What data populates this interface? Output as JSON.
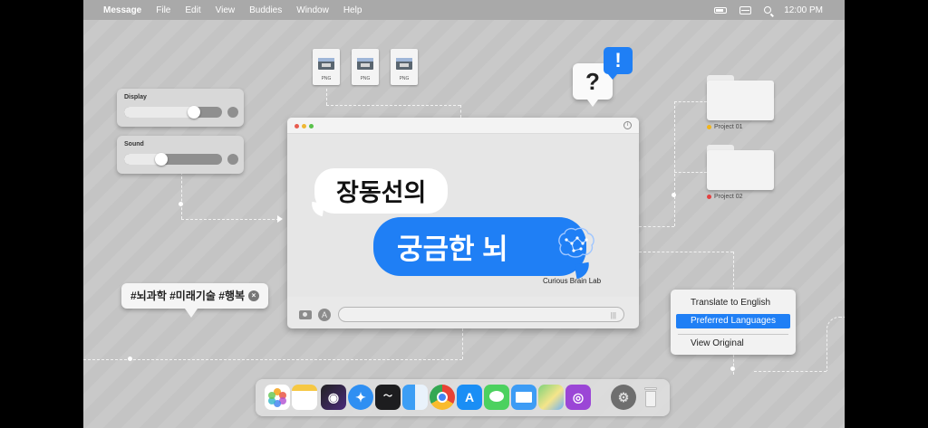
{
  "menubar": {
    "app": "Message",
    "items": [
      "File",
      "Edit",
      "View",
      "Buddies",
      "Window",
      "Help"
    ],
    "clock": "12:00 PM"
  },
  "panels": {
    "display": {
      "label": "Display",
      "level": 0.72
    },
    "sound": {
      "label": "Sound",
      "level": 0.37
    }
  },
  "files": [
    "PNG",
    "PNG",
    "PNG"
  ],
  "question": {
    "mark": "?",
    "badge": "!"
  },
  "folders": [
    {
      "label": "Project 01",
      "dot_color": "#f1b41a"
    },
    {
      "label": "Project 02",
      "dot_color": "#e34040"
    }
  ],
  "window": {
    "title_line1": "장동선의",
    "title_line2": "궁금한 뇌",
    "subtitle": "Curious Brain Lab",
    "info": "i"
  },
  "hashtags": {
    "text": "#뇌과학 #미래기술 #행복",
    "close": "×"
  },
  "context_menu": {
    "items": [
      "Translate to English",
      "Preferred Languages",
      "View Original"
    ],
    "selected_index": 1
  },
  "dock": {
    "icons": [
      "photos-icon",
      "notes-icon",
      "siri-icon",
      "safari-icon",
      "stocks-icon",
      "finder-icon",
      "chrome-icon",
      "app-store-icon",
      "messages-icon",
      "mail-icon",
      "maps-icon",
      "podcasts-icon",
      "system-preferences-icon",
      "trash-icon"
    ]
  },
  "colors": {
    "accent": "#1f7ff5",
    "background": "#c8c8c8",
    "menubar": "#a9a9a9"
  }
}
